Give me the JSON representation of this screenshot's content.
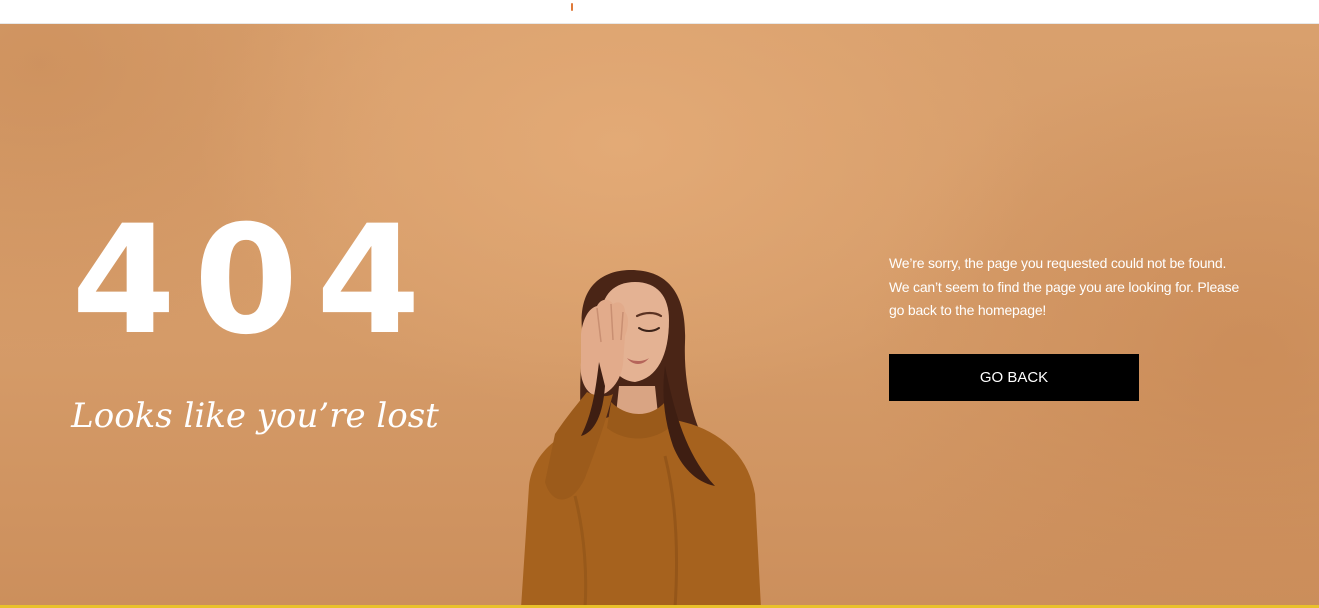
{
  "error": {
    "code": "404",
    "tagline": "Looks like you’re lost"
  },
  "message": {
    "lines": [
      "We’re sorry, the page you requested could not be found.",
      "We can’t seem to find the page you are looking for. Please",
      "go back to the homepage!"
    ]
  },
  "actions": {
    "go_back_label": "GO BACK"
  },
  "colors": {
    "background": "#dba370",
    "text": "#ffffff",
    "button_bg": "#000000",
    "bottom_accent": "#e9c12b"
  },
  "image": {
    "subject": "woman-facepalm-photo"
  }
}
